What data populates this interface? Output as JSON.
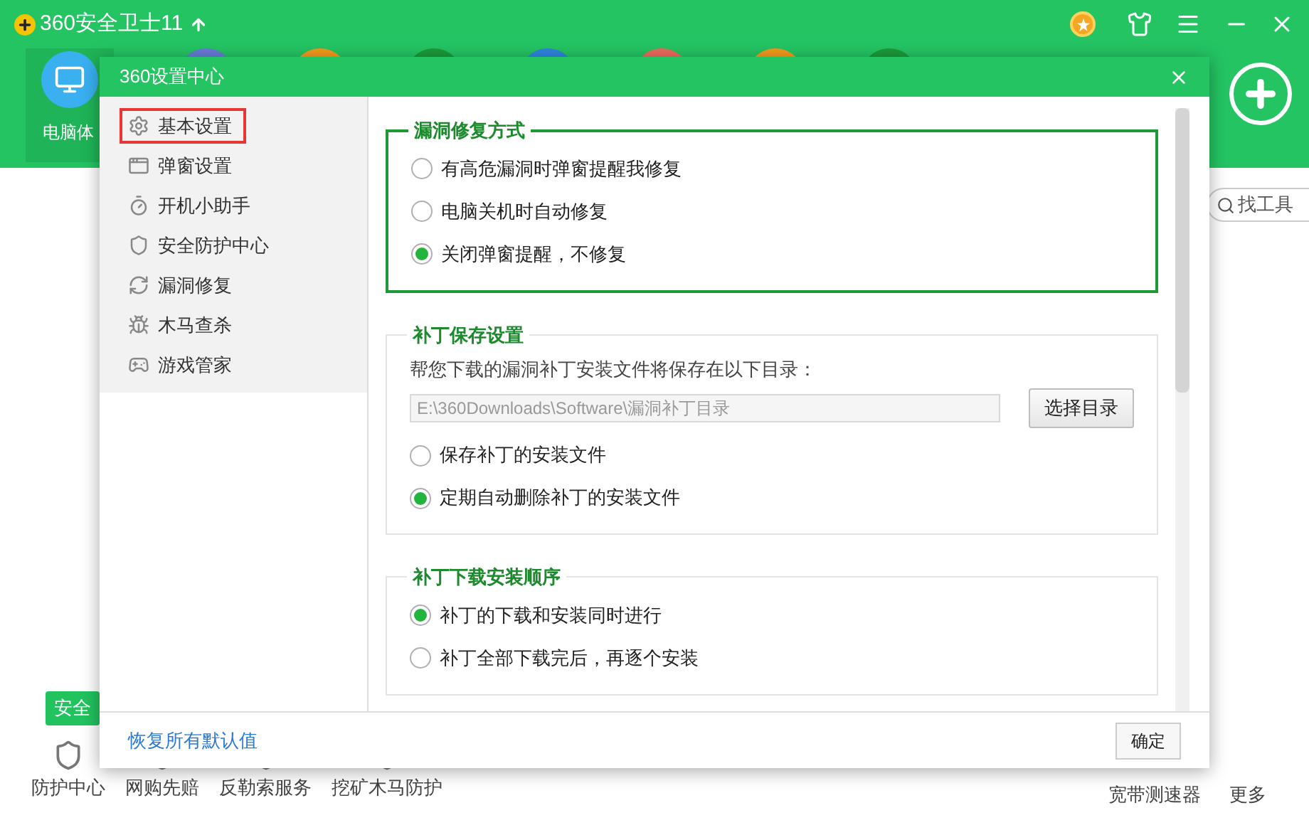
{
  "app": {
    "title": "360安全卫士11",
    "current_tab": "电脑体",
    "search_placeholder": "找工具",
    "tooltip": "安全",
    "bottom_items": [
      {
        "label": "防护中心"
      },
      {
        "label": "网购先赔"
      },
      {
        "label": "反勒索服务"
      },
      {
        "label": "挖矿木马防护"
      }
    ],
    "right_items": [
      {
        "label": "宽带测速器"
      },
      {
        "label": "更多"
      }
    ]
  },
  "dialog": {
    "title": "360设置中心",
    "sidebar": [
      {
        "label": "基本设置",
        "selected": true
      },
      {
        "label": "弹窗设置",
        "selected": false
      },
      {
        "label": "开机小助手",
        "selected": false
      },
      {
        "label": "安全防护中心",
        "selected": false
      },
      {
        "label": "漏洞修复",
        "selected": false
      },
      {
        "label": "木马查杀",
        "selected": false
      },
      {
        "label": "游戏管家",
        "selected": false
      }
    ],
    "sections": [
      {
        "title": "漏洞修复方式",
        "highlighted": true,
        "items": [
          {
            "kind": "radio",
            "label": "有高危漏洞时弹窗提醒我修复",
            "selected": false
          },
          {
            "kind": "radio",
            "label": "电脑关机时自动修复",
            "selected": false
          },
          {
            "kind": "radio",
            "label": "关闭弹窗提醒，不修复",
            "selected": true
          }
        ]
      },
      {
        "title": "补丁保存设置",
        "highlighted": false,
        "items": [
          {
            "kind": "text",
            "label": "帮您下载的漏洞补丁安装文件将保存在以下目录："
          },
          {
            "kind": "path",
            "value": "E:\\360Downloads\\Software\\漏洞补丁目录",
            "button": "选择目录"
          },
          {
            "kind": "radio",
            "label": "保存补丁的安装文件",
            "selected": false
          },
          {
            "kind": "radio",
            "label": "定期自动删除补丁的安装文件",
            "selected": true
          }
        ]
      },
      {
        "title": "补丁下载安装顺序",
        "highlighted": false,
        "items": [
          {
            "kind": "radio",
            "label": "补丁的下载和安装同时进行",
            "selected": true
          },
          {
            "kind": "radio",
            "label": "补丁全部下载完后，再逐个安装",
            "selected": false
          }
        ]
      }
    ],
    "reset_link": "恢复所有默认值",
    "ok_button": "确定"
  }
}
